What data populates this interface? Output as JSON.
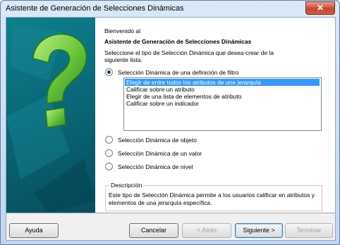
{
  "window": {
    "title": "Asistente de Generación de Selecciones Dinámicas",
    "close_glyph": "✕"
  },
  "header": {
    "welcome": "Bienvenido al",
    "wizard_name": "Asistente de Generación de Selecciones Dinámicas",
    "instruction_line1": "Seleccione el tipo de Selección Dinámica que desea crear de la",
    "instruction_line2": "siguiente lista."
  },
  "options": {
    "filter": {
      "label": "Selección Dinámica de una definición de filtro",
      "selected": true
    },
    "object": {
      "label": "Selección Dinámica de objeto",
      "selected": false
    },
    "value": {
      "label": "Selección Dinámica de un valor",
      "selected": false
    },
    "level": {
      "label": "Selección Dinámica de nivel",
      "selected": false
    }
  },
  "filter_list": {
    "items": [
      "Elegir de entre todos los atributos de una jerarquía",
      "Calificar sobre un atributo",
      "Elegir de una lista de elementos de atributo",
      "Calificar sobre un indicador"
    ],
    "selected_index": 0
  },
  "description": {
    "legend": "Descripción",
    "line1": "Este tipo de Selección Dinámica permite a los usuarios calificar en atributos y",
    "line2": "elementos de una jerarquía específica."
  },
  "buttons": {
    "help": "Ayuda",
    "cancel": "Cancelar",
    "back": "< Atrás",
    "next": "Siguiente >",
    "finish": "Terminar"
  },
  "colors": {
    "selection": "#3399ff",
    "art_teal": "#0a6878",
    "art_green": "#6dc83c"
  },
  "icons": {
    "wizard_art": "question-mark-art"
  }
}
